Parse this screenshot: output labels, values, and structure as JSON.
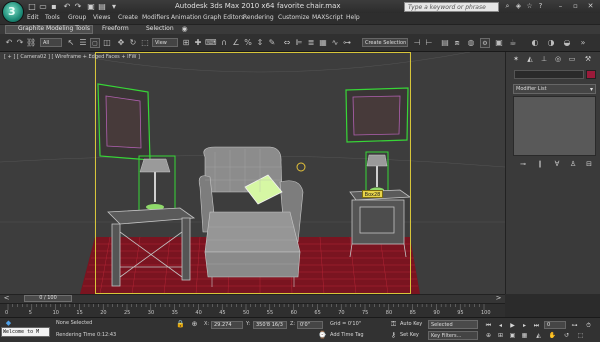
{
  "app": {
    "title": "Autodesk 3ds Max  2010 x64",
    "file": "favorite chair.max",
    "logo_glyph": "3",
    "search_placeholder": "Type a keyword or phrase"
  },
  "menu": [
    "Edit",
    "Tools",
    "Group",
    "Views",
    "Create",
    "Modifiers",
    "Animation",
    "Graph Editors",
    "Rendering",
    "Customize",
    "MAXScript",
    "Help"
  ],
  "ribbon": {
    "tabs": [
      "Graphite Modeling Tools",
      "Freeform",
      "Selection"
    ]
  },
  "toolbar": {
    "filter_value": "All",
    "refcoord_value": "View",
    "selection_set": "Create Selection S"
  },
  "viewport": {
    "label": "[ + ] [ Camera02 ] [ Wireframe + Edged Faces + IFW ]",
    "selection_tag": "Box28"
  },
  "command_panel": {
    "modifier_list": "Modifier List"
  },
  "timeline": {
    "slider_text": "0 / 100",
    "ticks": [
      "0",
      "5",
      "10",
      "15",
      "20",
      "25",
      "30",
      "35",
      "40",
      "45",
      "50",
      "55",
      "60",
      "65",
      "70",
      "75",
      "80",
      "85",
      "90",
      "95",
      "100"
    ]
  },
  "status": {
    "listener_text": "Welcome to M",
    "selection_text": "None Selected",
    "render_time": "Rendering Time  0:12:43",
    "x_label": "X:",
    "x_value": "29.274",
    "y_label": "Y:",
    "y_value": "350'8 16/3",
    "z_label": "Z:",
    "z_value": "0'0\"",
    "grid_text": "Grid = 0'10\"",
    "add_time_tag": "Add Time Tag",
    "auto_key": "Auto Key",
    "selected": "Selected",
    "set_key": "Set Key",
    "key_filters": "Key Filters...",
    "frame_value": "0"
  },
  "colors": {
    "accent_viewport_border": "#d7c53a",
    "selection_green": "#37d637",
    "floor_grid_red": "#a61a28",
    "object_color_swatch": "#9a1a3a"
  }
}
